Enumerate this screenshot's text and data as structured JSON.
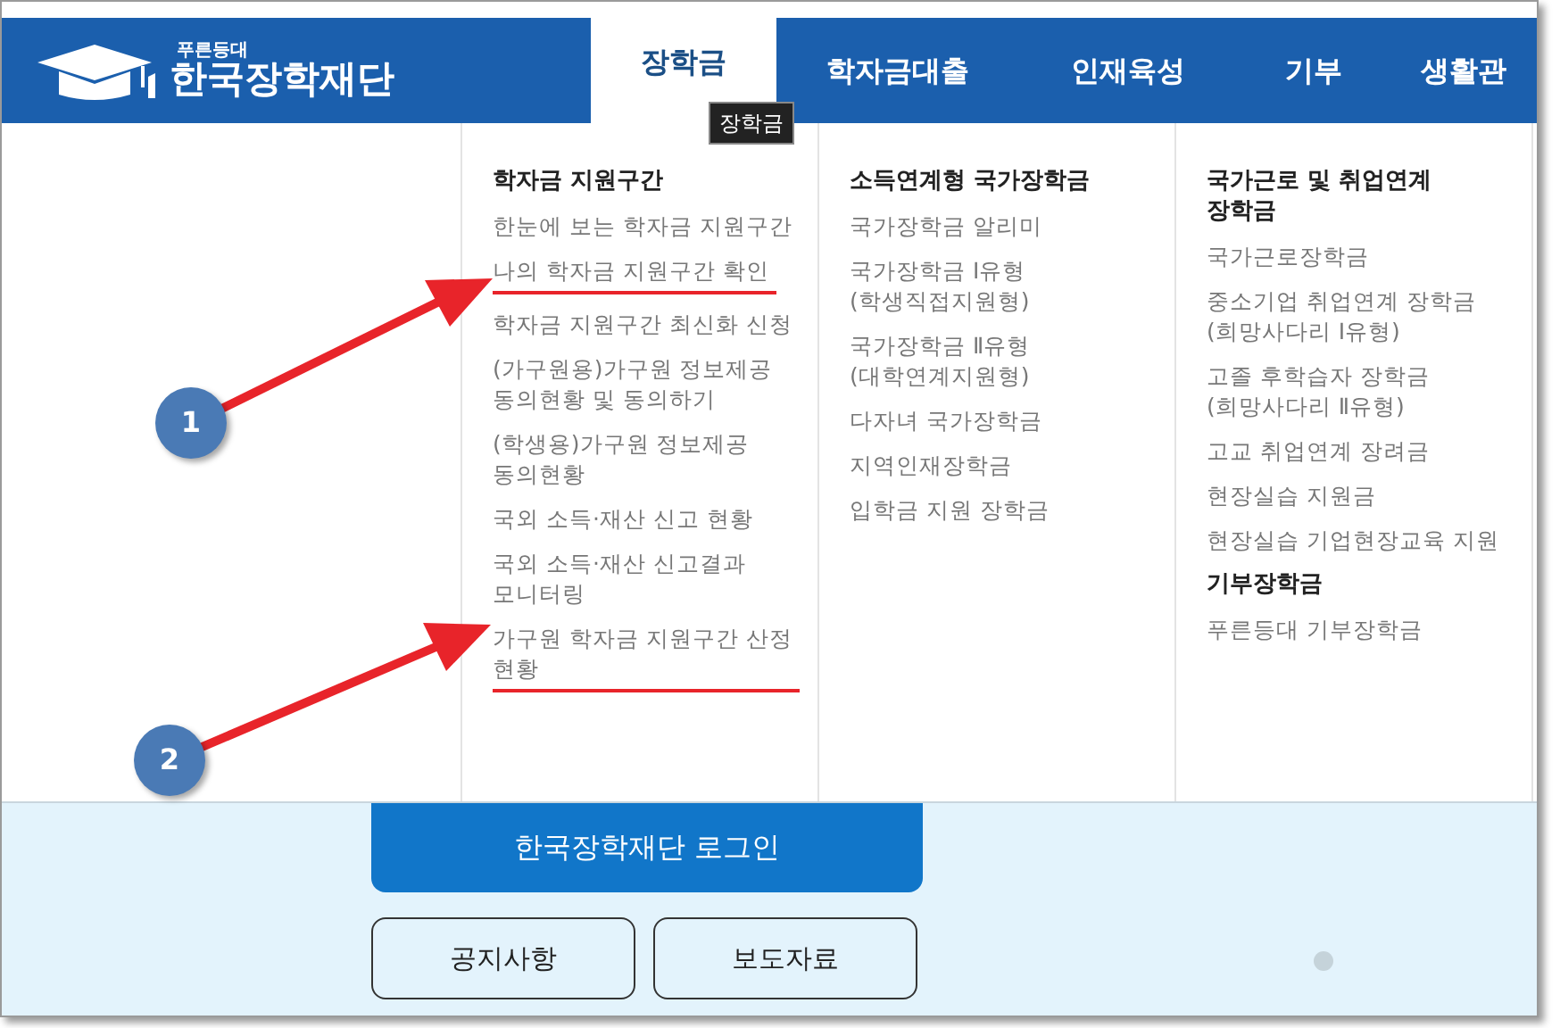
{
  "header": {
    "logo": {
      "tagline": "푸른등대",
      "name": "한국장학재단"
    },
    "nav": [
      {
        "label": "장학금",
        "selected": true
      },
      {
        "label": "학자금대출",
        "selected": false
      },
      {
        "label": "인재육성",
        "selected": false
      },
      {
        "label": "기부",
        "selected": false
      },
      {
        "label": "생활관",
        "selected": false
      }
    ],
    "tooltip": "장학금"
  },
  "menu": {
    "columns": [
      {
        "sections": [
          {
            "heading": "학자금 지원구간",
            "items": [
              {
                "label": "한눈에 보는 학자금 지원구간",
                "underlined": false
              },
              {
                "label": "나의 학자금 지원구간 확인",
                "underlined": true
              },
              {
                "label": "학자금 지원구간 최신화 신청",
                "underlined": false
              },
              {
                "label": "(가구원용)가구원 정보제공\n동의현황 및 동의하기",
                "underlined": false
              },
              {
                "label": "(학생용)가구원 정보제공\n동의현황",
                "underlined": false
              },
              {
                "label": "국외 소득·재산 신고 현황",
                "underlined": false
              },
              {
                "label": "국외 소득·재산 신고결과\n모니터링",
                "underlined": false
              },
              {
                "label": "가구원 학자금 지원구간 산정\n현황",
                "underlined": true
              }
            ]
          }
        ]
      },
      {
        "sections": [
          {
            "heading": "소득연계형 국가장학금",
            "items": [
              {
                "label": "국가장학금 알리미",
                "underlined": false
              },
              {
                "label": "국가장학금 Ⅰ유형\n(학생직접지원형)",
                "underlined": false
              },
              {
                "label": "국가장학금 Ⅱ유형\n(대학연계지원형)",
                "underlined": false
              },
              {
                "label": "다자녀 국가장학금",
                "underlined": false
              },
              {
                "label": "지역인재장학금",
                "underlined": false
              },
              {
                "label": "입학금 지원 장학금",
                "underlined": false
              }
            ]
          }
        ]
      },
      {
        "sections": [
          {
            "heading": "국가근로 및 취업연계\n장학금",
            "items": [
              {
                "label": "국가근로장학금",
                "underlined": false
              },
              {
                "label": "중소기업 취업연계 장학금\n(희망사다리 Ⅰ유형)",
                "underlined": false
              },
              {
                "label": "고졸 후학습자 장학금\n(희망사다리 Ⅱ유형)",
                "underlined": false
              },
              {
                "label": "고교 취업연계 장려금",
                "underlined": false
              },
              {
                "label": "현장실습 지원금",
                "underlined": false
              },
              {
                "label": "현장실습 기업현장교육 지원",
                "underlined": false
              }
            ]
          },
          {
            "heading": "기부장학금",
            "items": [
              {
                "label": "푸른등대 기부장학금",
                "underlined": false
              }
            ]
          }
        ]
      }
    ]
  },
  "annotations": [
    {
      "label": "1"
    },
    {
      "label": "2"
    }
  ],
  "login_button": "한국장학재단 로그인",
  "quick_buttons": [
    "공지사항",
    "보도자료"
  ]
}
